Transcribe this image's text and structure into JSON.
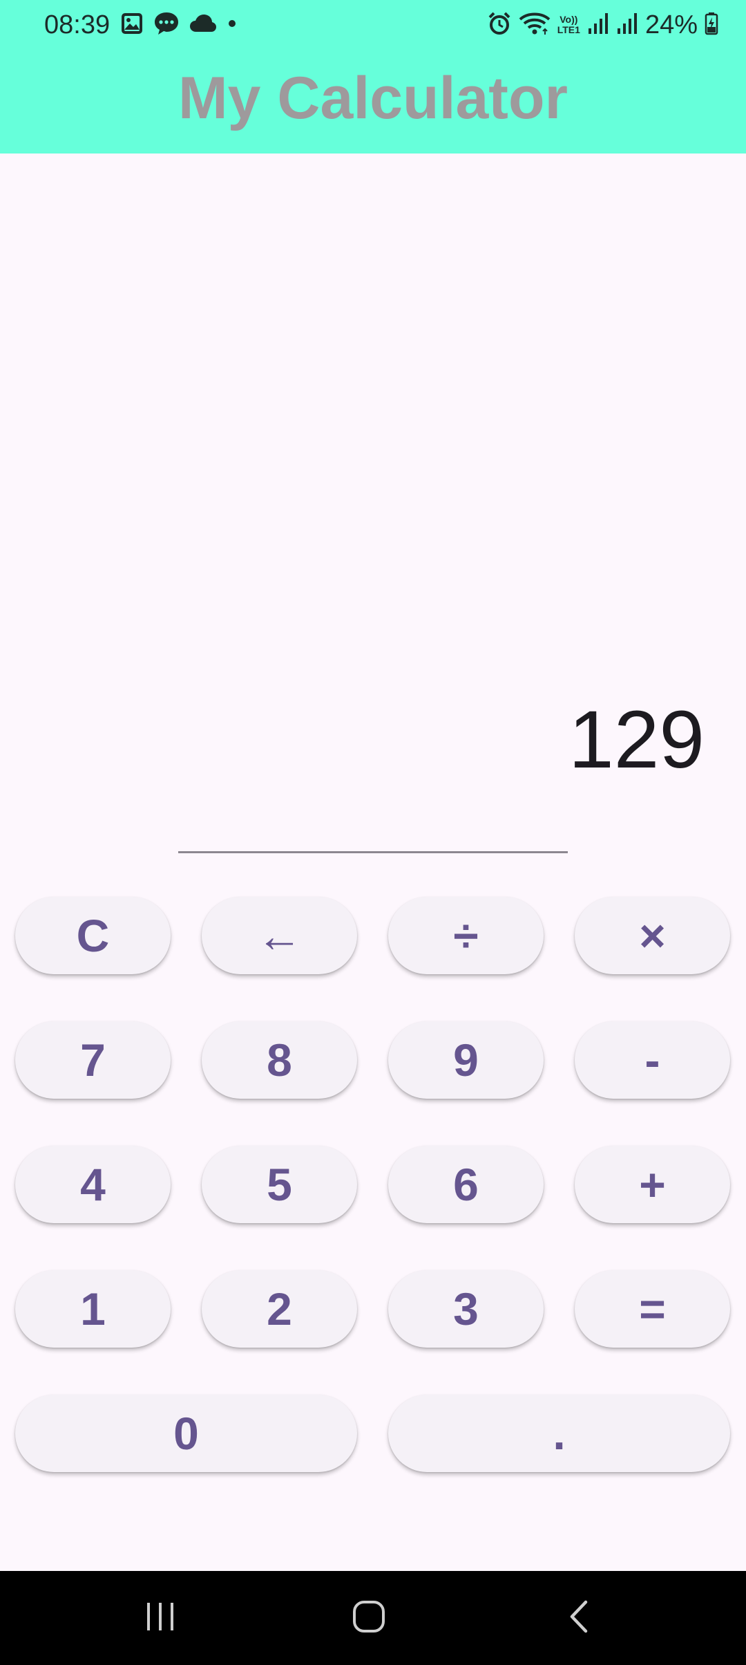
{
  "status_bar": {
    "time": "08:39",
    "battery": "24%",
    "left_icons": [
      "gallery-icon",
      "chat-icon",
      "cloud-icon",
      "dot-icon"
    ],
    "right_icons": [
      "alarm-icon",
      "wifi-icon",
      "volte-icon",
      "signal-icon",
      "signal-icon",
      "battery-icon"
    ],
    "volte_label_top": "Vo))",
    "volte_label_bottom": "LTE1"
  },
  "app": {
    "title": "My Calculator",
    "header_color": "#66FFDA"
  },
  "display": {
    "value": "129"
  },
  "keypad": {
    "rows": [
      [
        "C",
        "←",
        "÷",
        "×"
      ],
      [
        "7",
        "8",
        "9",
        "-"
      ],
      [
        "4",
        "5",
        "6",
        "+"
      ],
      [
        "1",
        "2",
        "3",
        "="
      ],
      [
        "0",
        "."
      ]
    ],
    "key_text_color": "#65558F",
    "key_bg_color": "#F5F1F7"
  },
  "nav_bar": {
    "buttons": [
      "recent-apps-icon",
      "home-icon",
      "back-icon"
    ]
  }
}
